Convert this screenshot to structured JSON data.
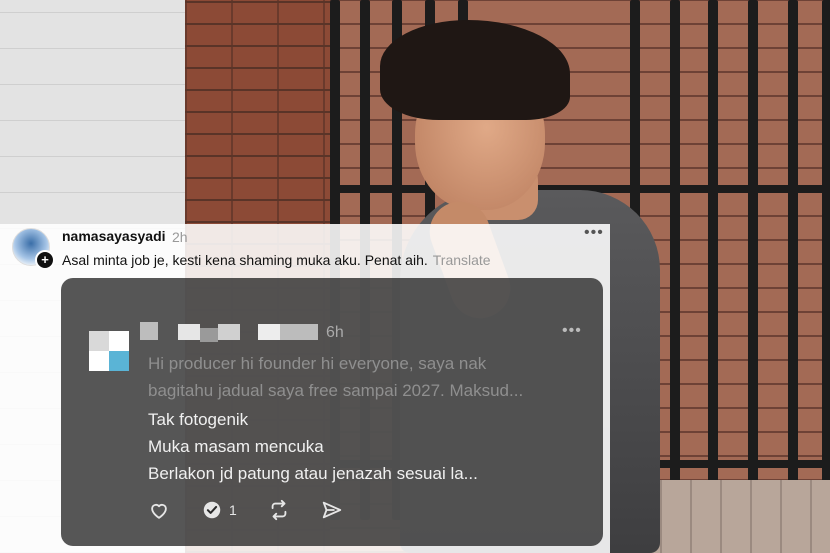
{
  "post": {
    "username": "namasayasyadi",
    "time": "2h",
    "caption": "Asal minta job je, kesti kena shaming muka aku. Penat aih.",
    "translate": "Translate",
    "more": "•••"
  },
  "quoted_post": {
    "time": "6h",
    "more": "•••",
    "faded_line_1": "Hi producer hi founder hi everyone, saya nak",
    "faded_line_2": "bagitahu jadual saya free sampai 2027. Maksud...",
    "line_1": "Tak fotogenik",
    "line_2": "Muka masam mencuka",
    "line_3": "Berlakon jd patung atau jenazah sesuai la...",
    "actions": {
      "like_icon": "heart-icon",
      "reply_icon": "reply-icon",
      "reply_count": "1",
      "repost_icon": "repost-icon",
      "share_icon": "send-icon"
    }
  },
  "colors": {
    "quote_bg": "#161616",
    "muted": "#999999"
  }
}
